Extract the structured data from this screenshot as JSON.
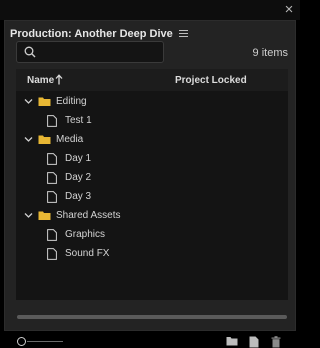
{
  "panel": {
    "title": "Production: Another Deep Dive"
  },
  "search": {
    "value": "",
    "placeholder": ""
  },
  "item_count": "9 items",
  "columns": {
    "name": "Name",
    "project_locked": "Project Locked"
  },
  "tree": [
    {
      "label": "Editing",
      "type": "folder",
      "level": 0,
      "expanded": true
    },
    {
      "label": "Test 1",
      "type": "file",
      "level": 1
    },
    {
      "label": "Media",
      "type": "folder",
      "level": 0,
      "expanded": true
    },
    {
      "label": "Day 1",
      "type": "file",
      "level": 1
    },
    {
      "label": "Day 2",
      "type": "file",
      "level": 1
    },
    {
      "label": "Day 3",
      "type": "file",
      "level": 1
    },
    {
      "label": "Shared Assets",
      "type": "folder",
      "level": 0,
      "expanded": true
    },
    {
      "label": "Graphics",
      "type": "file",
      "level": 1
    },
    {
      "label": "Sound FX",
      "type": "file",
      "level": 1
    }
  ],
  "icons": {
    "close": "close-icon",
    "menu": "hamburger-menu-icon",
    "search": "search-icon",
    "sort": "sort-ascending-arrow-icon",
    "folder": "folder-icon",
    "file": "document-icon",
    "new_folder": "new-folder-icon",
    "new_item": "new-document-icon",
    "delete": "trash-icon"
  },
  "colors": {
    "folder": "#e8b734",
    "panel_bg": "#232323",
    "list_bg": "#141414"
  }
}
